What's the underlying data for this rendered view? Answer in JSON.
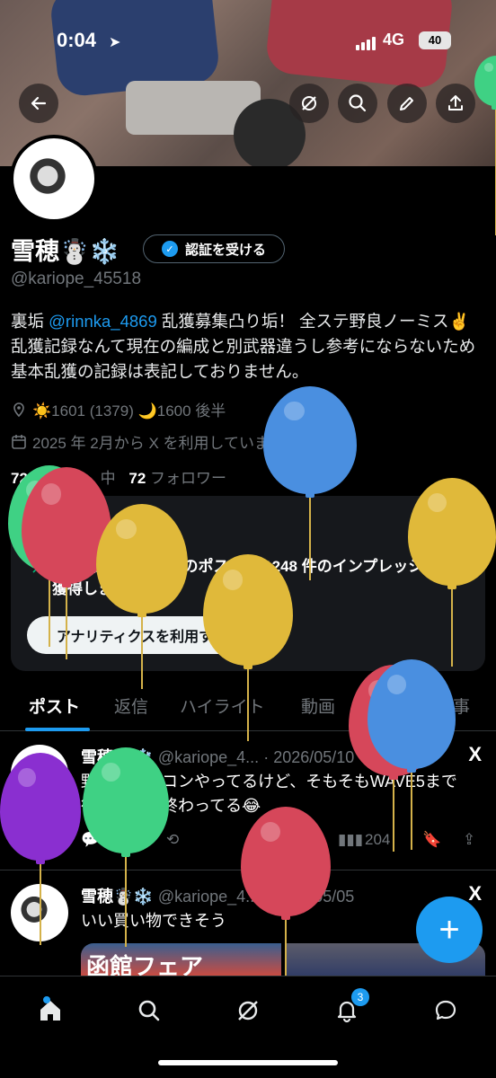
{
  "status_bar": {
    "time": "0:04",
    "network": "4G",
    "battery": "40"
  },
  "profile": {
    "display_name": "雪穂☃️❄️",
    "verify_button": "認証を受ける",
    "handle": "@kariope_45518",
    "bio_prefix": "裏垢 ",
    "bio_mention": "@rinnka_4869",
    "bio_rest": " 乱獲募集凸り垢！ 全ステ野良ノーミス✌️ 乱獲記録なんて現在の編成と別武器違うし参考にならないため基本乱獲の記録は表記しておりません。",
    "location": "☀️1601 (1379) 🌙1600 後半",
    "joined": "2025 年 2月から X を利用しています",
    "following_count": "72",
    "following_label": "中",
    "followers_count": "72",
    "followers_label": "フォロワー"
  },
  "analytics_card": {
    "message": "過去7日間にあなたのポストは 1248 件のインプレッションを獲得しました",
    "button": "アナリティクスを利用する"
  },
  "tabs": [
    "ポスト",
    "返信",
    "ハイライト",
    "動画",
    "記事"
  ],
  "posts": [
    {
      "name": "雪穂☃️❄️",
      "handle": "@kariope_4...",
      "date": "· 2026/05/10",
      "text": "野良でパチコンやってるけど、そもそもWAVE5まで行けないの終わってる😂",
      "views": "204"
    },
    {
      "name": "雪穂☃️❄️",
      "handle": "@kariope_4...",
      "date": "· 2026/05/05",
      "text": "いい買い物できそう",
      "media_text": "函館フェア"
    }
  ],
  "nav": {
    "notifications_badge": "3"
  },
  "icons": {
    "back": "back-arrow-icon",
    "grok": "grok-icon",
    "search": "search-icon",
    "edit": "pencil-icon",
    "share": "share-icon",
    "home": "home-icon",
    "notifications": "bell-icon",
    "messages": "message-icon"
  },
  "colors": {
    "accent": "#1d9bf0",
    "background": "#000000",
    "muted": "#71767b"
  }
}
